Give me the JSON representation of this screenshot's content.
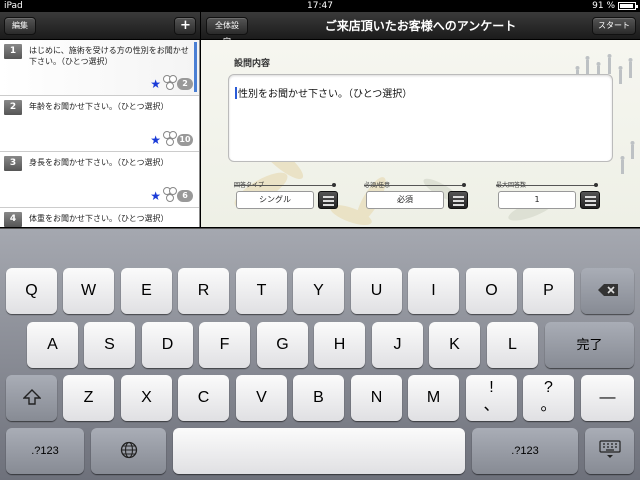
{
  "status": {
    "device": "iPad",
    "time": "17:47",
    "battery": "91 %",
    "battery_level": 0.91
  },
  "left_nav": {
    "edit": "編集",
    "add": "+"
  },
  "right_nav": {
    "settings": "全体設定",
    "title": "ご来店頂いたお客様へのアンケート",
    "start": "スタート"
  },
  "questions": [
    {
      "num": "1",
      "text": "はじめに、施術を受ける方の性別をお聞かせ下さい。（ひとつ選択）",
      "count": "2",
      "selected": true
    },
    {
      "num": "2",
      "text": "年齢をお聞かせ下さい。（ひとつ選択）",
      "count": "10",
      "selected": false
    },
    {
      "num": "3",
      "text": "身長をお聞かせ下さい。（ひとつ選択）",
      "count": "6",
      "selected": false
    },
    {
      "num": "4",
      "text": "体重をお聞かせ下さい。（ひとつ選択）",
      "count": "",
      "selected": false
    }
  ],
  "editor": {
    "label": "設問内容",
    "question_text": "性別をお聞かせ下さい。（ひとつ選択）",
    "fields": [
      {
        "label": "回答タイプ",
        "value": "シングル"
      },
      {
        "label": "必須/任意",
        "value": "必須"
      },
      {
        "label": "最大回答数",
        "value": "1"
      }
    ]
  },
  "keyboard": {
    "row1": [
      "Q",
      "W",
      "E",
      "R",
      "T",
      "Y",
      "U",
      "I",
      "O",
      "P"
    ],
    "row2": [
      "A",
      "S",
      "D",
      "F",
      "G",
      "H",
      "J",
      "K",
      "L"
    ],
    "row3": [
      "Z",
      "X",
      "C",
      "V",
      "B",
      "N",
      "M"
    ],
    "excl": "!",
    "excl_sub": "、",
    "quest": "?",
    "quest_sub": "。",
    "dash": "—",
    "enter": "完了",
    "num1": ".?123",
    "num2": ".?123"
  }
}
